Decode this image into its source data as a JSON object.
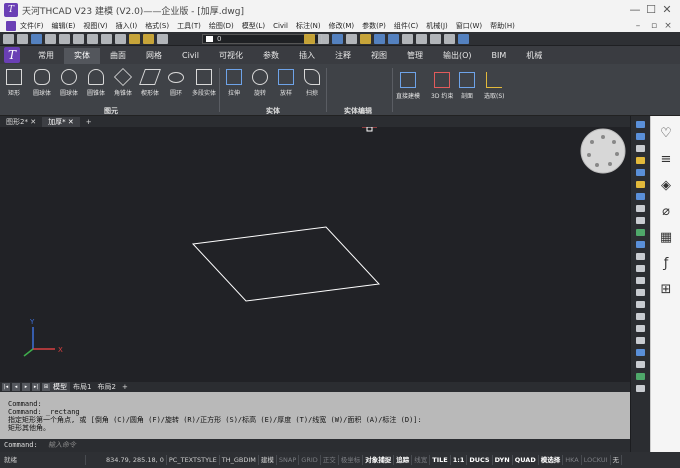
{
  "window": {
    "title": "天河THCAD V23 建模 (V2.0)——企业版 - [加厚.dwg]",
    "minimize": "—",
    "maximize": "☐",
    "close": "✕"
  },
  "menubar": {
    "items": [
      "文件(F)",
      "编辑(E)",
      "视图(V)",
      "插入(I)",
      "格式(S)",
      "工具(T)",
      "绘图(D)",
      "模型(L)",
      "Civil",
      "标注(N)",
      "修改(M)",
      "参数(P)",
      "组件(C)",
      "机械(J)",
      "窗口(W)",
      "帮助(H)"
    ],
    "doc_minimize": "–",
    "doc_restore": "▫",
    "doc_close": "×"
  },
  "qat": {
    "layer_value": "0"
  },
  "ribbon_tabs": [
    "常用",
    "实体",
    "曲面",
    "网格",
    "Civil",
    "可视化",
    "参数",
    "插入",
    "注释",
    "视图",
    "管理",
    "输出(O)",
    "BIM",
    "机械"
  ],
  "ribbon_active_tab": "实体",
  "ribbon": {
    "primitives": [
      "矩形",
      "圆球体",
      "圆球体",
      "圆锥体",
      "角锥体",
      "楔形体",
      "圆环",
      "多段实体"
    ],
    "primitives_panel": "图元",
    "solid_tools": [
      "拉伸",
      "旋转",
      "放样",
      "扫掠"
    ],
    "solid_panel": "实体",
    "edit_panel": "实体编辑",
    "extra": [
      "直接建模",
      "3D 约束",
      "剖面",
      "选取(S)"
    ]
  },
  "doc_tabs": [
    {
      "label": "图形2*",
      "close": "✕"
    },
    {
      "label": "加厚*",
      "close": "✕"
    },
    {
      "label": "+",
      "close": ""
    }
  ],
  "layout_tabs": [
    "模型",
    "布局1",
    "布局2",
    "+"
  ],
  "command_history": [
    "Command:",
    "Command: _rectang",
    "指定矩形第一个角点, 或 [倒角 (C)/圆角 (F)/旋转 (R)/正方形 (S)/标高 (E)/厚度 (T)/线宽 (W)/面积 (A)/标注 (D)]:",
    "矩形其他角。"
  ],
  "command_prompt": "Command:",
  "command_placeholder": "输入命令",
  "status": {
    "mode": "就绪",
    "coords": "834.79, 285.18, 0",
    "items": [
      {
        "label": "PC_TEXTSTYLE",
        "state": "normal"
      },
      {
        "label": "TH_GBDIM",
        "state": "normal"
      },
      {
        "label": "建模",
        "state": "normal"
      },
      {
        "label": "SNAP",
        "state": "off"
      },
      {
        "label": "GRID",
        "state": "off"
      },
      {
        "label": "正交",
        "state": "off"
      },
      {
        "label": "极坐标",
        "state": "off"
      },
      {
        "label": "对象捕捉",
        "state": "on"
      },
      {
        "label": "追踪",
        "state": "on"
      },
      {
        "label": "线宽",
        "state": "off"
      },
      {
        "label": "TILE",
        "state": "on"
      },
      {
        "label": "1:1",
        "state": "on"
      },
      {
        "label": "DUCS",
        "state": "on"
      },
      {
        "label": "DYN",
        "state": "on"
      },
      {
        "label": "QUAD",
        "state": "on"
      },
      {
        "label": "模选择",
        "state": "on"
      },
      {
        "label": "HKA",
        "state": "off"
      },
      {
        "label": "LOCKUI",
        "state": "off"
      },
      {
        "label": "无",
        "state": "normal"
      }
    ]
  },
  "ucs": {
    "y": "Y",
    "x": "X"
  },
  "colors": {
    "accent": "#6a3fb5",
    "canvas": "#212226",
    "rect_line": "#ffffff"
  }
}
